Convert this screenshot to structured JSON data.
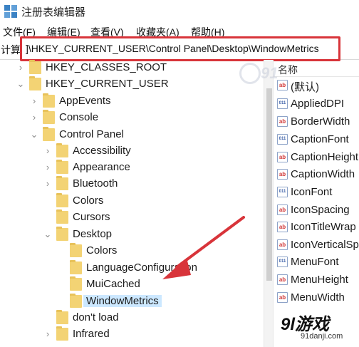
{
  "window": {
    "title": "注册表编辑器"
  },
  "menu": [
    "文件(F)",
    "编辑(E)",
    "查看(V)",
    "收藏夹(A)",
    "帮助(H)"
  ],
  "address": {
    "prefix": "计算",
    "path": "]\\HKEY_CURRENT_USER\\Control Panel\\Desktop\\WindowMetrics"
  },
  "tree": [
    {
      "label": "HKEY_CLASSES_ROOT",
      "expander": "›"
    },
    {
      "label": "HKEY_CURRENT_USER",
      "expander": "⌄"
    },
    {
      "label": "AppEvents",
      "expander": "›"
    },
    {
      "label": "Console",
      "expander": "›"
    },
    {
      "label": "Control Panel",
      "expander": "⌄"
    },
    {
      "label": "Accessibility",
      "expander": "›"
    },
    {
      "label": "Appearance",
      "expander": "›"
    },
    {
      "label": "Bluetooth",
      "expander": "›"
    },
    {
      "label": "Colors",
      "expander": ""
    },
    {
      "label": "Cursors",
      "expander": ""
    },
    {
      "label": "Desktop",
      "expander": "⌄"
    },
    {
      "label": "Colors",
      "expander": ""
    },
    {
      "label": "LanguageConfiguration",
      "expander": ""
    },
    {
      "label": "MuiCached",
      "expander": ""
    },
    {
      "label": "WindowMetrics",
      "expander": ""
    },
    {
      "label": "don't load",
      "expander": ""
    },
    {
      "label": "Infrared",
      "expander": "›"
    }
  ],
  "values": {
    "header": "名称",
    "rows": [
      {
        "name": "(默认)",
        "type": "ab"
      },
      {
        "name": "AppliedDPI",
        "type": "bin"
      },
      {
        "name": "BorderWidth",
        "type": "ab"
      },
      {
        "name": "CaptionFont",
        "type": "bin"
      },
      {
        "name": "CaptionHeight",
        "type": "ab"
      },
      {
        "name": "CaptionWidth",
        "type": "ab"
      },
      {
        "name": "IconFont",
        "type": "bin"
      },
      {
        "name": "IconSpacing",
        "type": "ab"
      },
      {
        "name": "IconTitleWrap",
        "type": "ab"
      },
      {
        "name": "IconVerticalSp",
        "type": "ab"
      },
      {
        "name": "MenuFont",
        "type": "bin"
      },
      {
        "name": "MenuHeight",
        "type": "ab"
      },
      {
        "name": "MenuWidth",
        "type": "ab"
      }
    ]
  },
  "watermark": {
    "logo": "9l游戏",
    "url": "91danji.com",
    "top_logo": "91"
  },
  "colors": {
    "highlight_box": "#d8343a",
    "arrow": "#d8343a",
    "selection": "#cce8ff",
    "folder": "#f3d374"
  }
}
